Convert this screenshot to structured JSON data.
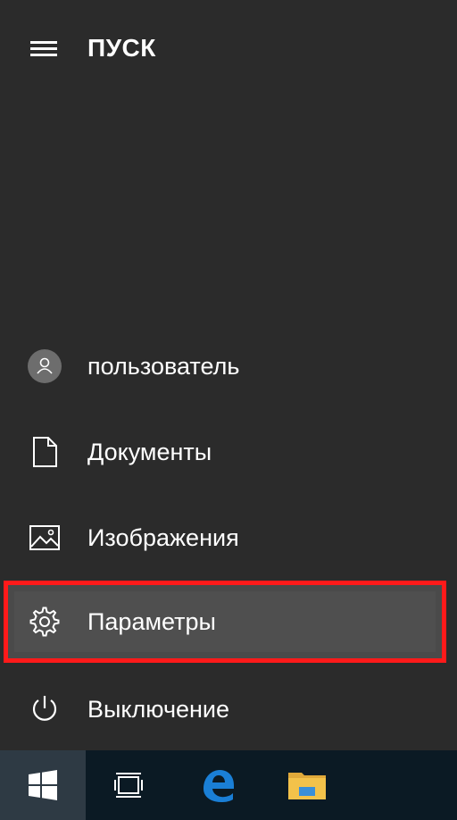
{
  "start_menu": {
    "title": "ПУСК",
    "items": [
      {
        "label": "пользователь",
        "icon": "user-avatar-icon"
      },
      {
        "label": "Документы",
        "icon": "document-icon"
      },
      {
        "label": "Изображения",
        "icon": "picture-icon"
      },
      {
        "label": "Параметры",
        "icon": "gear-icon",
        "highlighted": true
      },
      {
        "label": "Выключение",
        "icon": "power-icon"
      }
    ]
  },
  "taskbar": {
    "buttons": [
      {
        "icon": "windows-logo-icon"
      },
      {
        "icon": "task-view-icon"
      },
      {
        "icon": "edge-browser-icon"
      },
      {
        "icon": "file-explorer-icon"
      }
    ]
  },
  "colors": {
    "background": "#2b2b2b",
    "highlight_border": "#ff1a1a",
    "highlight_fill": "#4f4f4f",
    "taskbar": "#0b1a24",
    "edge_blue": "#1a7fd6",
    "folder_yellow": "#f3c24a"
  }
}
